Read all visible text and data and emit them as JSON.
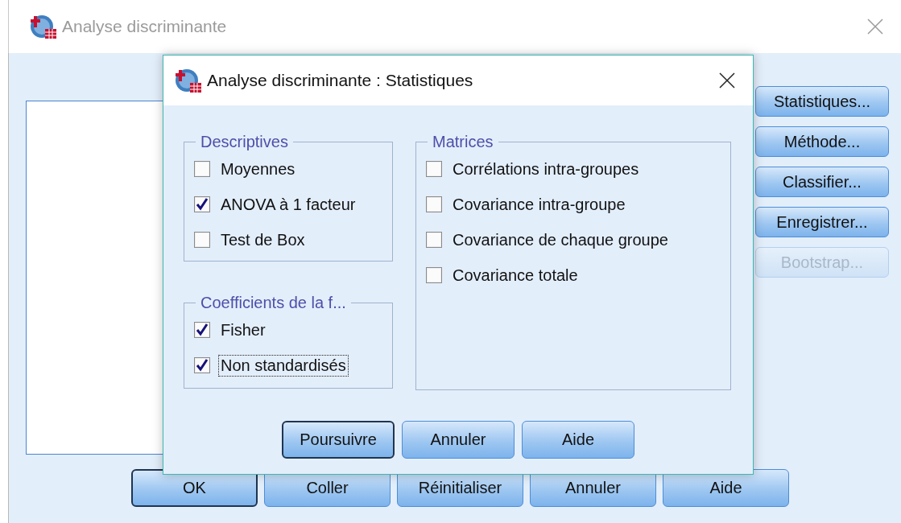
{
  "main_window": {
    "title": "Analyse discriminante",
    "side_buttons": [
      {
        "label": "Statistiques...",
        "disabled": false
      },
      {
        "label": "Méthode...",
        "disabled": false
      },
      {
        "label": "Classifier...",
        "disabled": false
      },
      {
        "label": "Enregistrer...",
        "disabled": false
      },
      {
        "label": "Bootstrap...",
        "disabled": true
      }
    ],
    "buttons": [
      {
        "label": "OK",
        "default": true
      },
      {
        "label": "Coller",
        "default": false
      },
      {
        "label": "Réinitialiser",
        "default": false
      },
      {
        "label": "Annuler",
        "default": false
      },
      {
        "label": "Aide",
        "default": false
      }
    ]
  },
  "dialog": {
    "title": "Analyse discriminante : Statistiques",
    "groups": [
      {
        "title": "Descriptives",
        "options": [
          {
            "label": "Moyennes",
            "checked": false,
            "focused": false
          },
          {
            "label": "ANOVA à 1 facteur",
            "checked": true,
            "focused": false
          },
          {
            "label": "Test de Box",
            "checked": false,
            "focused": false
          }
        ]
      },
      {
        "title": "Coefficients de la f...",
        "options": [
          {
            "label": "Fisher",
            "checked": true,
            "focused": false
          },
          {
            "label": "Non standardisés",
            "checked": true,
            "focused": true
          }
        ]
      },
      {
        "title": "Matrices",
        "options": [
          {
            "label": "Corrélations intra-groupes",
            "checked": false,
            "focused": false
          },
          {
            "label": "Covariance intra-groupe",
            "checked": false,
            "focused": false
          },
          {
            "label": "Covariance de chaque groupe",
            "checked": false,
            "focused": false
          },
          {
            "label": "Covariance totale",
            "checked": false,
            "focused": false
          }
        ]
      }
    ],
    "buttons": [
      {
        "label": "Poursuivre",
        "default": true
      },
      {
        "label": "Annuler",
        "default": false
      },
      {
        "label": "Aide",
        "default": false
      }
    ]
  }
}
